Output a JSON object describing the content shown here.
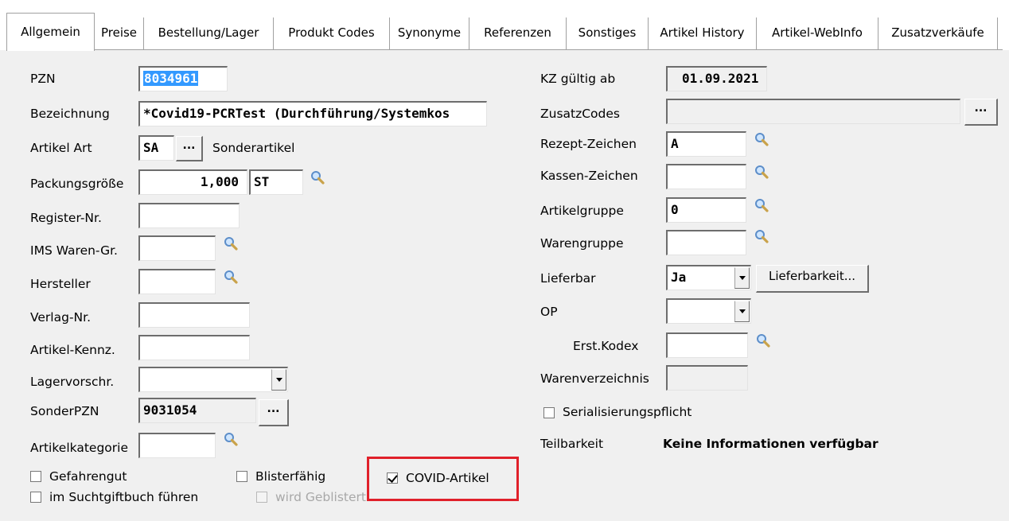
{
  "tabs": [
    "Allgemein",
    "Preise",
    "Bestellung/Lager",
    "Produkt Codes",
    "Synonyme",
    "Referenzen",
    "Sonstiges",
    "Artikel History",
    "Artikel-WebInfo",
    "Zusatzverkäufe"
  ],
  "active_tab": "Allgemein",
  "left": {
    "pzn": {
      "label": "PZN",
      "value": "8034961"
    },
    "bezeichnung": {
      "label": "Bezeichnung",
      "value": "*Covid19-PCRTest (Durchführung/Systemkos"
    },
    "artikel_art": {
      "label": "Artikel Art",
      "value": "SA",
      "button": "...",
      "text": "Sonderartikel"
    },
    "packungsgroesse": {
      "label": "Packungsgröße",
      "value": "1,000",
      "unit": "ST"
    },
    "register_nr": {
      "label": "Register-Nr.",
      "value": ""
    },
    "ims_waren_gr": {
      "label": "IMS Waren-Gr.",
      "value": ""
    },
    "hersteller": {
      "label": "Hersteller",
      "value": ""
    },
    "verlag_nr": {
      "label": "Verlag-Nr.",
      "value": ""
    },
    "artikel_kennz": {
      "label": "Artikel-Kennz.",
      "value": ""
    },
    "lagervorschr": {
      "label": "Lagervorschr.",
      "value": ""
    },
    "sonderpzn": {
      "label": "SonderPZN",
      "value": "9031054",
      "button": "..."
    },
    "artikelkategorie": {
      "label": "Artikelkategorie",
      "value": ""
    }
  },
  "right": {
    "kz_gueltig_ab": {
      "label": "KZ gültig ab",
      "value": "01.09.2021"
    },
    "zusatzcodes": {
      "label": "ZusatzCodes",
      "value": "",
      "button": "..."
    },
    "rezept_zeichen": {
      "label": "Rezept-Zeichen",
      "value": "A"
    },
    "kassen_zeichen": {
      "label": "Kassen-Zeichen",
      "value": ""
    },
    "artikelgruppe": {
      "label": "Artikelgruppe",
      "value": "0"
    },
    "warengruppe": {
      "label": "Warengruppe",
      "value": ""
    },
    "lieferbar": {
      "label": "Lieferbar",
      "value": "Ja",
      "button": "Lieferbarkeit..."
    },
    "op": {
      "label": "OP",
      "value": ""
    },
    "erst_kodex": {
      "label": "Erst.Kodex",
      "value": ""
    },
    "warenverzeichnis": {
      "label": "Warenverzeichnis",
      "value": ""
    },
    "serialisierungspflicht": {
      "label": "Serialisierungspflicht",
      "checked": false
    },
    "teilbarkeit": {
      "label": "Teilbarkeit",
      "value": "Keine Informationen verfügbar"
    }
  },
  "checkboxes": {
    "gefahrengut": {
      "label": "Gefahrengut",
      "checked": false
    },
    "suchtgiftbuch": {
      "label": "im Suchtgiftbuch führen",
      "checked": false
    },
    "blisterfaehig": {
      "label": "Blisterfähig",
      "checked": false
    },
    "wird_geblistert": {
      "label": "wird Geblistert",
      "checked": false,
      "disabled": true
    },
    "covid_artikel": {
      "label": "COVID-Artikel",
      "checked": true
    }
  },
  "colors": {
    "highlight": "#e0202a",
    "selection": "#3399ff",
    "panel": "#f0f0f0"
  },
  "icons": {
    "lookup": "magnifier-icon",
    "dropdown": "chevron-down-icon"
  }
}
